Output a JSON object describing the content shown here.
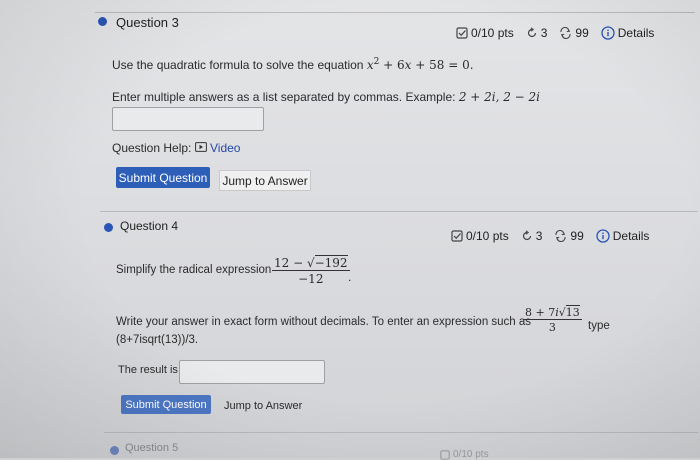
{
  "q3": {
    "title": "Question 3",
    "points": "0/10 pts",
    "attempts": "3",
    "retries": "99",
    "details": "Details",
    "prompt_prefix": "Use the quadratic formula to solve the equation ",
    "prompt_x": "x",
    "prompt_exp": "2",
    "prompt_mid": " + 6",
    "prompt_x2": "x",
    "prompt_end": " + 58 = 0.",
    "instruction_prefix": "Enter multiple answers as a list separated by commas. Example: ",
    "instruction_example": "2 + 2i, 2 − 2i",
    "help_label": "Question Help:",
    "video_label": "Video",
    "submit_label": "Submit Question",
    "jump_label": "Jump to Answer"
  },
  "q4": {
    "title": "Question 4",
    "points": "0/10 pts",
    "attempts": "3",
    "retries": "99",
    "details": "Details",
    "prompt_prefix": "Simplify the radical expression",
    "frac_num_a": "12 − ",
    "frac_num_rad": "−192",
    "frac_den": "−12",
    "frac_tail": ".",
    "write_prefix": "Write your answer in exact form without decimals. To enter an expression such as",
    "ex_num_a": "8 + 7",
    "ex_num_i": "i",
    "ex_num_rad": "13",
    "ex_den": "3",
    "type_label": "type",
    "example_text": "(8+7isqrt(13))/3.",
    "result_label": "The result is",
    "submit_label": "Submit Question",
    "jump_label": "Jump to Answer"
  },
  "q5": {
    "title": "Question 5",
    "points": "0/10 pts"
  },
  "icons": {
    "points": "checkbox-icon",
    "attempts": "refresh-icon",
    "retries": "retry-arrows-icon",
    "details": "info-circle-icon",
    "video": "video-play-icon"
  },
  "colors": {
    "accent": "#2a54b5",
    "button": "#2e5fb8",
    "link": "#2649a8"
  }
}
